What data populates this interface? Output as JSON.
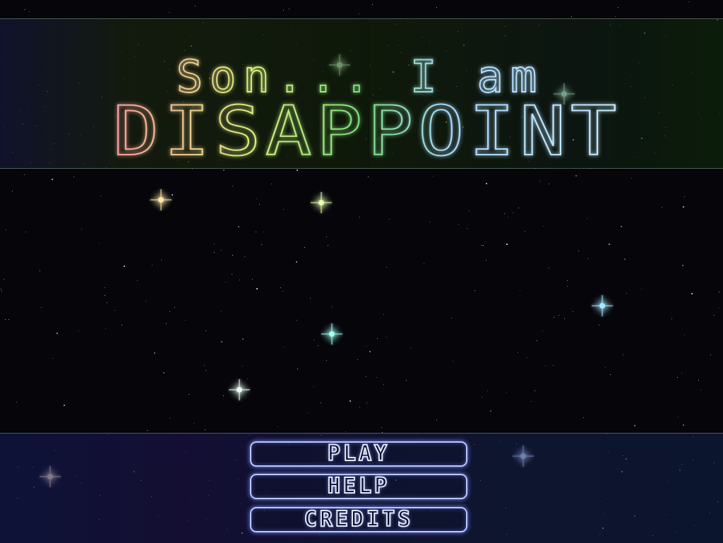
{
  "title": {
    "line1": "Son... I am",
    "line2": "DISAPPOINT",
    "gradient_colors": [
      "#ff9aa0",
      "#d9f07a",
      "#7ae07a",
      "#a8d8ff"
    ]
  },
  "menu": {
    "items": [
      {
        "label": "PLAY"
      },
      {
        "label": "HELP"
      },
      {
        "label": "CREDITS"
      }
    ]
  },
  "colors": {
    "background": "#05050a",
    "button_outline": "#b9c8ff",
    "button_glow": "#7c8cff"
  }
}
